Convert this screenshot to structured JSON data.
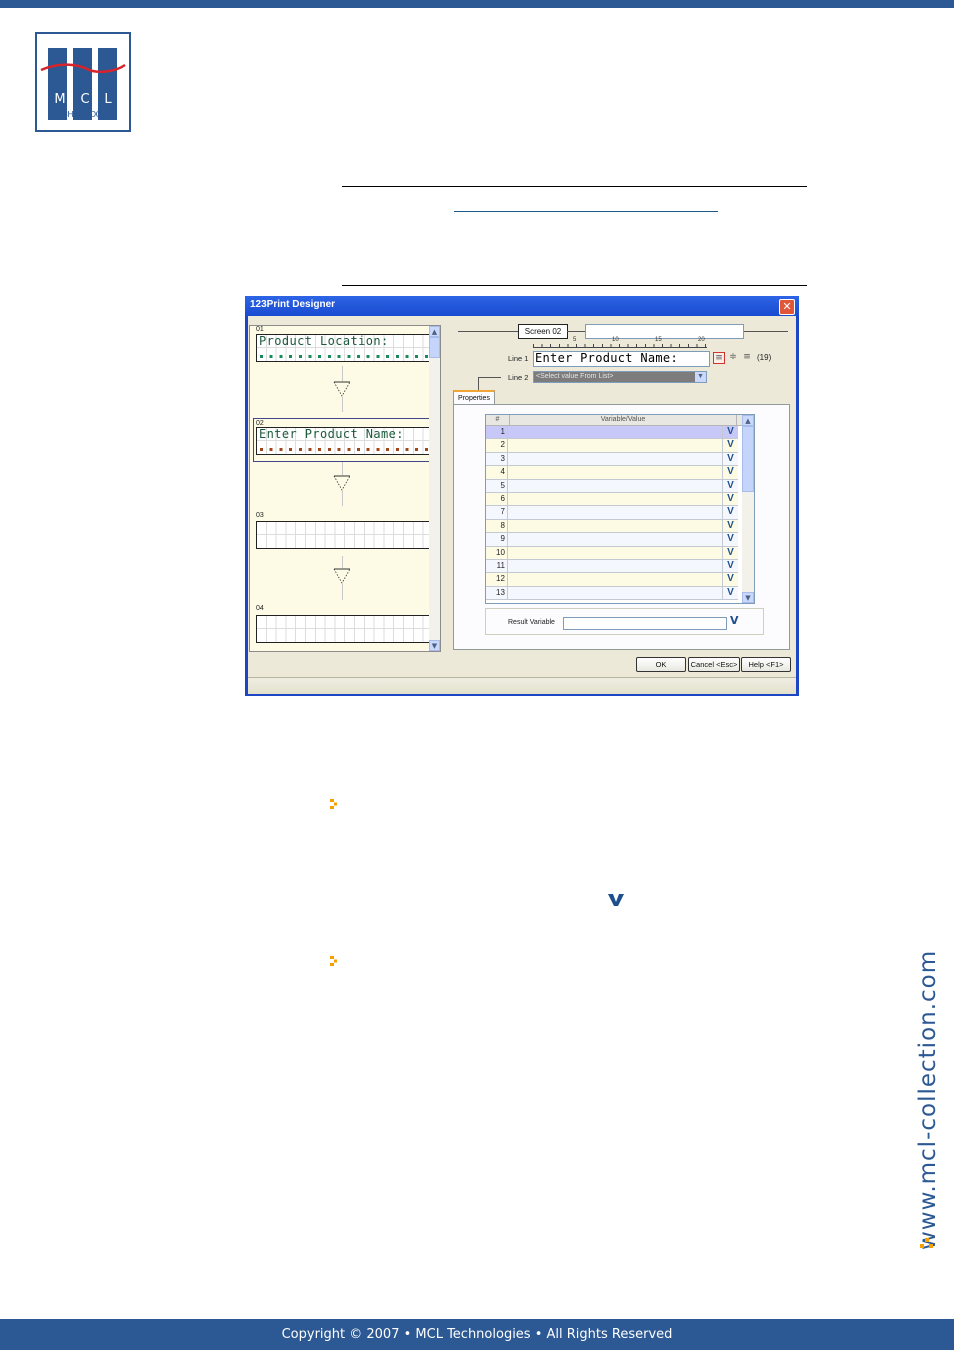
{
  "page": {
    "logo": {
      "letters": [
        "M",
        "C",
        "L"
      ],
      "subtitle": "TECHNOLOGIES"
    },
    "side_url": "www.mcl-collection.com",
    "footer": "Copyright © 2007 • MCL Technologies • All Rights Reserved",
    "colors": {
      "brand_blue": "#2c5894",
      "accent_orange": "#f5a000",
      "logo_red": "#d8232a"
    }
  },
  "dialog": {
    "title": "123Print Designer",
    "close_glyph": "✕",
    "screens": [
      {
        "number": "01",
        "text": "Product Location:",
        "dot_color": "#1a8a5a"
      },
      {
        "number": "02",
        "text": "Enter Product Name:",
        "dot_color": "#a0481c",
        "selected": true
      },
      {
        "number": "03",
        "text": ""
      },
      {
        "number": "04",
        "text": ""
      }
    ],
    "editor": {
      "screen_label": "Screen 02",
      "screen_name_value": "",
      "ruler_marks": [
        "5",
        "10",
        "15",
        "20"
      ],
      "line1_label": "Line 1",
      "line1_value": "Enter Product Name:",
      "alignment": "left",
      "char_count": "(19)",
      "line2_label": "Line 2",
      "line2_value": "<Select value From List>",
      "tab_label": "Properties",
      "grid": {
        "columns": [
          "#",
          "Variable/Value",
          ""
        ],
        "rows": [
          "1",
          "2",
          "3",
          "4",
          "5",
          "6",
          "7",
          "8",
          "9",
          "10",
          "11",
          "12",
          "13"
        ],
        "selected_row": "1",
        "row_button": "V"
      },
      "result_variable_label": "Result Variable",
      "result_variable_value": "",
      "result_button": "V"
    },
    "buttons": {
      "ok": "OK",
      "cancel": "Cancel <Esc>",
      "help": "Help <F1>"
    }
  }
}
